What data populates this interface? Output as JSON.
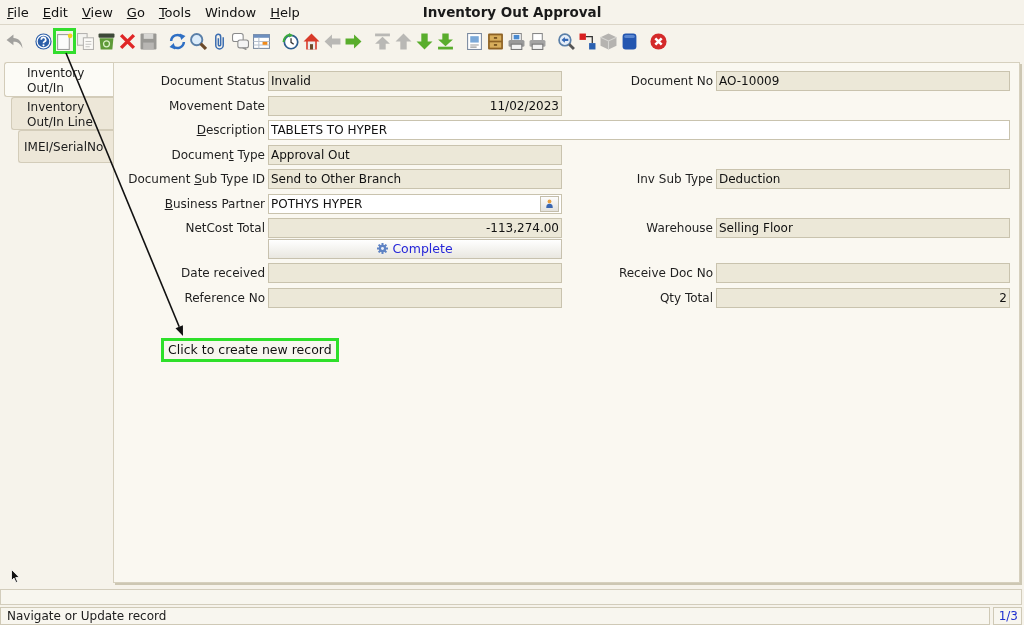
{
  "window": {
    "title": "Inventory Out Approval"
  },
  "menu": [
    {
      "label": [
        {
          "text": "F",
          "underlined": true
        },
        {
          "text": "ile",
          "underlined": false
        }
      ]
    },
    {
      "label": [
        {
          "text": "E",
          "underlined": true
        },
        {
          "text": "dit",
          "underlined": false
        }
      ]
    },
    {
      "label": [
        {
          "text": "V",
          "underlined": true
        },
        {
          "text": "iew",
          "underlined": false
        }
      ]
    },
    {
      "label": [
        {
          "text": "G",
          "underlined": true
        },
        {
          "text": "o",
          "underlined": false
        }
      ]
    },
    {
      "label": [
        {
          "text": "T",
          "underlined": true
        },
        {
          "text": "ools",
          "underlined": false
        }
      ]
    },
    {
      "label": [
        {
          "text": "Window",
          "underlined": false
        }
      ]
    },
    {
      "label": [
        {
          "text": "H",
          "underlined": true
        },
        {
          "text": "elp",
          "underlined": false
        }
      ]
    }
  ],
  "toolbar": [
    {
      "kind": "undo",
      "disabled": true,
      "highlighted": false
    },
    {
      "kind": "separator"
    },
    {
      "kind": "help",
      "disabled": false,
      "highlighted": false
    },
    {
      "kind": "new",
      "disabled": false,
      "highlighted": true
    },
    {
      "kind": "copy",
      "disabled": true,
      "highlighted": false
    },
    {
      "kind": "recycle",
      "disabled": false,
      "highlighted": false
    },
    {
      "kind": "delete",
      "disabled": false,
      "highlighted": false
    },
    {
      "kind": "save",
      "disabled": true,
      "highlighted": false
    },
    {
      "kind": "separator"
    },
    {
      "kind": "refresh",
      "disabled": false,
      "highlighted": false
    },
    {
      "kind": "find",
      "disabled": false,
      "highlighted": false
    },
    {
      "kind": "attach",
      "disabled": false,
      "highlighted": false
    },
    {
      "kind": "chat",
      "disabled": false,
      "highlighted": false
    },
    {
      "kind": "grid",
      "disabled": false,
      "highlighted": false
    },
    {
      "kind": "separator"
    },
    {
      "kind": "history",
      "disabled": false,
      "highlighted": false
    },
    {
      "kind": "home",
      "disabled": false,
      "highlighted": false
    },
    {
      "kind": "previous",
      "disabled": true,
      "highlighted": false
    },
    {
      "kind": "next",
      "disabled": false,
      "highlighted": false
    },
    {
      "kind": "separator"
    },
    {
      "kind": "first",
      "disabled": true,
      "highlighted": false
    },
    {
      "kind": "up",
      "disabled": true,
      "highlighted": false
    },
    {
      "kind": "down",
      "disabled": false,
      "highlighted": false
    },
    {
      "kind": "last",
      "disabled": false,
      "highlighted": false
    },
    {
      "kind": "separator"
    },
    {
      "kind": "report",
      "disabled": false,
      "highlighted": false
    },
    {
      "kind": "archive",
      "disabled": false,
      "highlighted": false
    },
    {
      "kind": "preview",
      "disabled": false,
      "highlighted": false
    },
    {
      "kind": "print",
      "disabled": false,
      "highlighted": false
    },
    {
      "kind": "separator"
    },
    {
      "kind": "zoom",
      "disabled": false,
      "highlighted": false
    },
    {
      "kind": "workflow",
      "disabled": false,
      "highlighted": false
    },
    {
      "kind": "product",
      "disabled": true,
      "highlighted": false
    },
    {
      "kind": "tile",
      "disabled": false,
      "highlighted": false
    },
    {
      "kind": "separator"
    },
    {
      "kind": "exit",
      "disabled": false,
      "highlighted": false
    }
  ],
  "tabs": [
    {
      "label": "Inventory Out/In",
      "selected": true
    },
    {
      "label": "Inventory Out/In Line",
      "selected": false
    },
    {
      "label": "IMEI/SerialNo",
      "selected": false
    }
  ],
  "form": {
    "rows": [
      {
        "cells": [
          {
            "kind": "text",
            "label": [
              {
                "text": "Document Status",
                "underlined": false
              }
            ],
            "value": "Invalid",
            "editable": false
          },
          {
            "kind": "text",
            "label": [
              {
                "text": "Document No",
                "underlined": false
              }
            ],
            "value": "AO-10009",
            "editable": false
          }
        ]
      },
      {
        "cells": [
          {
            "kind": "date",
            "label": [
              {
                "text": "Movement Date",
                "underlined": false
              }
            ],
            "value": "11/02/2023",
            "editable": false
          }
        ]
      },
      {
        "cells": [
          {
            "kind": "long-text",
            "label": [
              {
                "text": "D",
                "underlined": true
              },
              {
                "text": "escription",
                "underlined": false
              }
            ],
            "value": "TABLETS TO HYPER",
            "editable": true
          }
        ]
      },
      {
        "cells": [
          {
            "kind": "text",
            "label": [
              {
                "text": "Documen",
                "underlined": false
              },
              {
                "text": "t",
                "underlined": true
              },
              {
                "text": " Type",
                "underlined": false
              }
            ],
            "value": "Approval Out",
            "editable": false
          }
        ]
      },
      {
        "cells": [
          {
            "kind": "text",
            "label": [
              {
                "text": "Document ",
                "underlined": false
              },
              {
                "text": "S",
                "underlined": true
              },
              {
                "text": "ub Type ID",
                "underlined": false
              }
            ],
            "value": "Send to Other Branch",
            "editable": false
          },
          {
            "kind": "text",
            "label": [
              {
                "text": "Inv Sub Type",
                "underlined": false
              }
            ],
            "value": "Deduction",
            "editable": false
          }
        ]
      },
      {
        "cells": [
          {
            "kind": "search",
            "label": [
              {
                "text": "B",
                "underlined": true
              },
              {
                "text": "usiness Partner",
                "underlined": false
              }
            ],
            "value": "POTHYS HYPER",
            "editable": true
          }
        ]
      },
      {
        "cells": [
          {
            "kind": "number",
            "label": [
              {
                "text": "NetCost Total",
                "underlined": false
              }
            ],
            "value": "-113,274.00",
            "editable": false
          },
          {
            "kind": "text",
            "label": [
              {
                "text": "Warehouse",
                "underlined": false
              }
            ],
            "value": "Selling Floor",
            "editable": false
          }
        ]
      },
      {
        "cells": [
          {
            "kind": "action",
            "text": "Complete"
          }
        ]
      },
      {
        "cells": [
          {
            "kind": "date",
            "label": [
              {
                "text": "Date received",
                "underlined": false
              }
            ],
            "editable": false
          },
          {
            "kind": "text",
            "label": [
              {
                "text": "Receive Doc No",
                "underlined": false
              }
            ],
            "editable": false
          }
        ]
      },
      {
        "cells": [
          {
            "kind": "text",
            "label": [
              {
                "text": "Reference No",
                "underlined": false
              }
            ],
            "editable": false
          },
          {
            "kind": "number",
            "label": [
              {
                "text": "Qty Total",
                "underlined": false
              }
            ],
            "value": "2",
            "editable": false
          }
        ]
      }
    ]
  },
  "annotation": {
    "text": "Click to create new record"
  },
  "status_bar": {
    "message": "Navigate or Update record",
    "record_position": "1/3"
  }
}
